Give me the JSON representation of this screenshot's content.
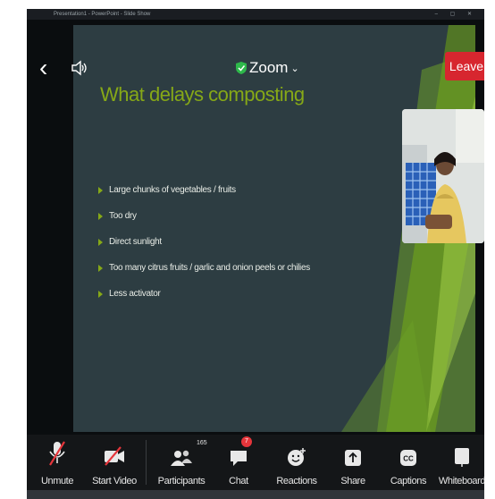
{
  "window_title": "Presentation1 - PowerPoint - Slide Show",
  "header": {
    "app_label": "Zoom",
    "leave_label": "Leave"
  },
  "slide": {
    "title": "What delays composting",
    "bullets": [
      "Large chunks of vegetables / fruits",
      "Too dry",
      "Direct sunlight",
      "Too many citrus fruits / garlic and onion peels or chilies",
      "Less activator"
    ]
  },
  "toolbar": {
    "unmute": "Unmute",
    "start_video": "Start Video",
    "participants": "Participants",
    "participants_count": "165",
    "chat": "Chat",
    "chat_badge": "7",
    "reactions": "Reactions",
    "share": "Share",
    "captions": "Captions",
    "whiteboard": "Whiteboard"
  },
  "colors": {
    "accent_green": "#86a817",
    "leave_red": "#d7262f",
    "slide_bg": "#2d3d42"
  },
  "icons": [
    "back-arrow-icon",
    "speaker-icon",
    "shield-check-icon",
    "chevron-down-icon",
    "muted-mic-icon",
    "video-off-icon",
    "participants-icon",
    "chat-icon",
    "reactions-icon",
    "share-icon",
    "captions-icon",
    "whiteboard-icon"
  ]
}
